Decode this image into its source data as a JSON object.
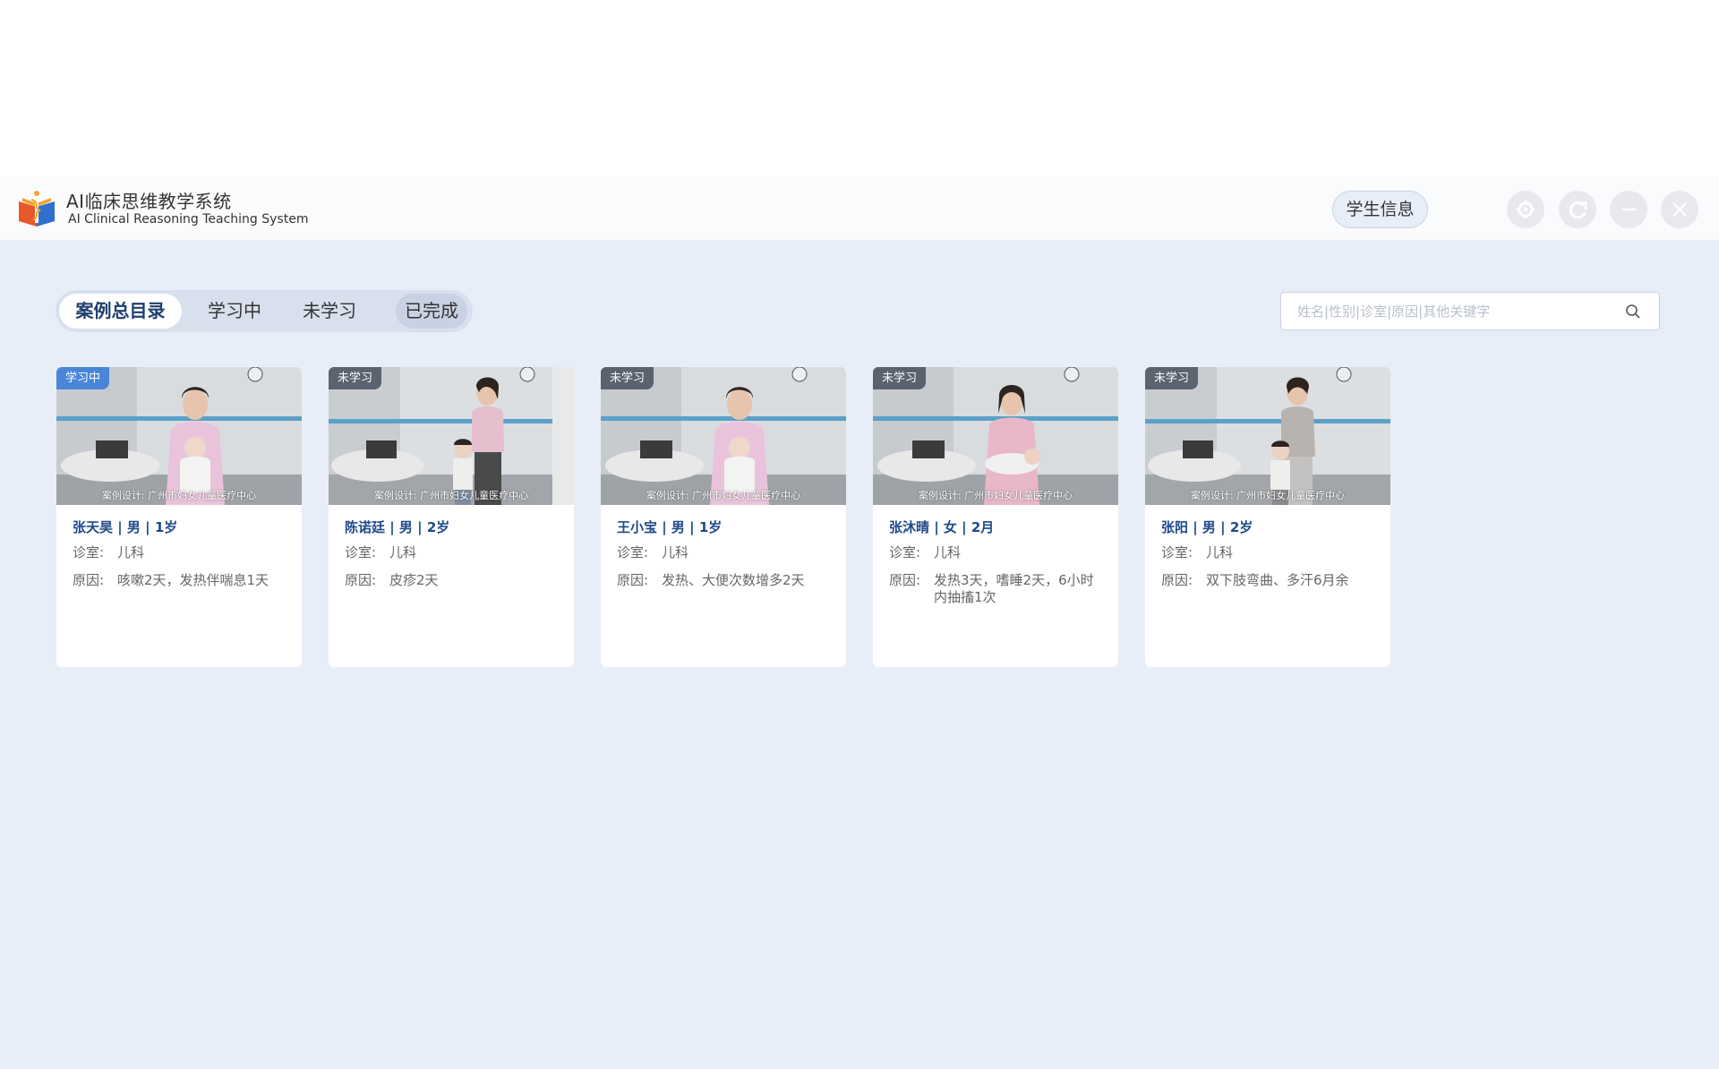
{
  "header": {
    "title_cn": "AI临床思维教学系统",
    "title_en": "AI Clinical Reasoning Teaching System",
    "student_info_label": "学生信息",
    "buttons": [
      "gear-icon",
      "refresh-icon",
      "minimize-icon",
      "close-icon"
    ]
  },
  "tabs": [
    {
      "label": "案例总目录",
      "state": "active"
    },
    {
      "label": "学习中",
      "state": "normal"
    },
    {
      "label": "未学习",
      "state": "normal"
    },
    {
      "label": "已完成",
      "state": "hover"
    }
  ],
  "search": {
    "placeholder": "姓名|性别|诊室|原因|其他关键字",
    "value": ""
  },
  "labels": {
    "clinic": "诊室:",
    "reason": "原因:"
  },
  "watermark": "案例设计: 广州市妇女儿童医疗中心",
  "cards": [
    {
      "badge": "学习中",
      "name": "张天昊 | 男 | 1岁",
      "clinic": "儿科",
      "reason": "咳嗽2天，发热伴喘息1天"
    },
    {
      "badge": "未学习",
      "name": "陈诺廷 | 男 | 2岁",
      "clinic": "儿科",
      "reason": "皮疹2天"
    },
    {
      "badge": "未学习",
      "name": "王小宝 | 男 | 1岁",
      "clinic": "儿科",
      "reason": "发热、大便次数增多2天"
    },
    {
      "badge": "未学习",
      "name": "张沐晴 | 女 | 2月",
      "clinic": "儿科",
      "reason": "发热3天，嗜睡2天，6小时内抽搐1次"
    },
    {
      "badge": "未学习",
      "name": "张阳 | 男 | 2岁",
      "clinic": "儿科",
      "reason": "双下肢弯曲、多汗6月余"
    }
  ],
  "colors": {
    "accent": "#1e4a8a",
    "background": "#e8eef8",
    "badge_learning": "#4a86d8"
  }
}
